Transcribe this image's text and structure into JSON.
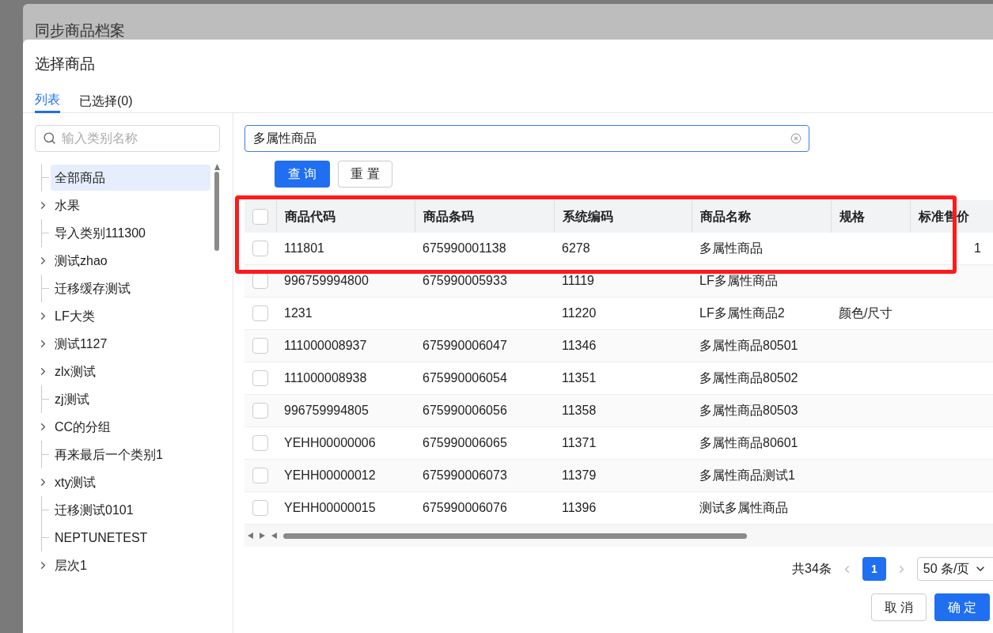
{
  "outer_dialog": {
    "title": "同步商品档案"
  },
  "dialog": {
    "title": "选择商品"
  },
  "tabs": [
    {
      "label": "列表",
      "selected": true
    },
    {
      "label": "已选择(0)",
      "selected": false
    }
  ],
  "category_search": {
    "placeholder": "输入类别名称"
  },
  "tree": [
    {
      "label": "全部商品",
      "expandable": false,
      "selected": true
    },
    {
      "label": "水果",
      "expandable": true,
      "selected": false
    },
    {
      "label": "导入类别111300",
      "expandable": false,
      "selected": false
    },
    {
      "label": "测试zhao",
      "expandable": true,
      "selected": false
    },
    {
      "label": "迁移缓存测试",
      "expandable": false,
      "selected": false
    },
    {
      "label": "LF大类",
      "expandable": true,
      "selected": false
    },
    {
      "label": "测试1127",
      "expandable": true,
      "selected": false
    },
    {
      "label": "zlx测试",
      "expandable": true,
      "selected": false
    },
    {
      "label": "zj测试",
      "expandable": false,
      "selected": false
    },
    {
      "label": "CC的分组",
      "expandable": true,
      "selected": false
    },
    {
      "label": "再来最后一个类别1",
      "expandable": false,
      "selected": false
    },
    {
      "label": "xty测试",
      "expandable": true,
      "selected": false
    },
    {
      "label": "迁移测试0101",
      "expandable": false,
      "selected": false
    },
    {
      "label": "NEPTUNETEST",
      "expandable": false,
      "selected": false
    },
    {
      "label": "层次1",
      "expandable": true,
      "selected": false
    }
  ],
  "product_search": {
    "value": "多属性商品"
  },
  "buttons": {
    "query": "查 询",
    "reset": "重 置"
  },
  "table": {
    "all_checked": false,
    "columns": [
      "商品代码",
      "商品条码",
      "系统编码",
      "商品名称",
      "规格",
      "标准售价"
    ],
    "rows": [
      {
        "checked": false,
        "cells": [
          "111801",
          "675990001138",
          "6278",
          "多属性商品",
          "",
          "1"
        ]
      },
      {
        "checked": false,
        "cells": [
          "996759994800",
          "675990005933",
          "11119",
          "LF多属性商品",
          "",
          ""
        ]
      },
      {
        "checked": false,
        "cells": [
          "1231",
          "",
          "11220",
          "LF多属性商品2",
          "颜色/尺寸",
          ""
        ]
      },
      {
        "checked": false,
        "cells": [
          "111000008937",
          "675990006047",
          "11346",
          "多属性商品80501",
          "",
          ""
        ]
      },
      {
        "checked": false,
        "cells": [
          "111000008938",
          "675990006054",
          "11351",
          "多属性商品80502",
          "",
          ""
        ]
      },
      {
        "checked": false,
        "cells": [
          "996759994805",
          "675990006056",
          "11358",
          "多属性商品80503",
          "",
          ""
        ]
      },
      {
        "checked": false,
        "cells": [
          "YEHH00000006",
          "675990006065",
          "11371",
          "多属性商品80601",
          "",
          ""
        ]
      },
      {
        "checked": false,
        "cells": [
          "YEHH00000012",
          "675990006073",
          "11379",
          "多属性商品测试1",
          "",
          ""
        ]
      },
      {
        "checked": false,
        "cells": [
          "YEHH00000015",
          "675990006076",
          "11396",
          "测试多属性商品",
          "",
          ""
        ]
      }
    ]
  },
  "pagination": {
    "total": "共34条",
    "pages": [
      {
        "label": "1",
        "selected": true
      }
    ],
    "page_size": "50 条/页"
  },
  "footer": {
    "cancel": "取 消",
    "confirm": "确 定"
  }
}
